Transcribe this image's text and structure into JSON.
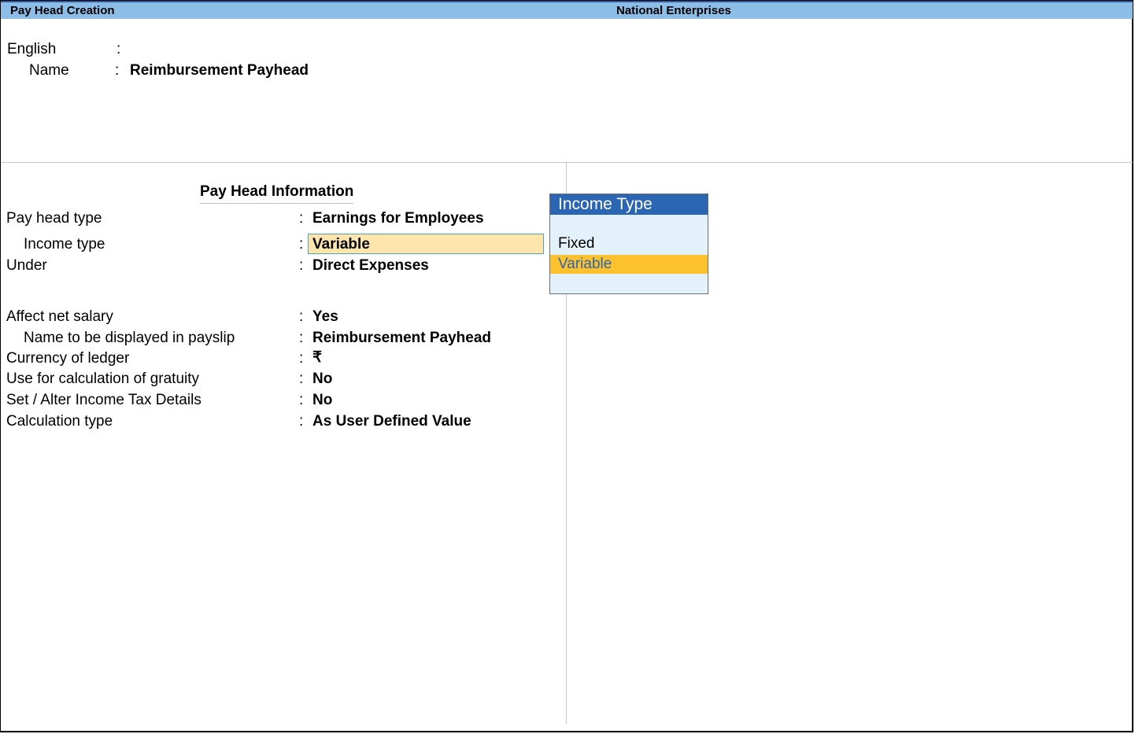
{
  "titlebar": {
    "screen_title": "Pay Head  Creation",
    "company": "National Enterprises"
  },
  "name_section": {
    "language_label": "English",
    "name_label": "Name",
    "name_value": "Reimbursement Payhead",
    "separator": ":"
  },
  "info_section": {
    "title": "Pay Head Information",
    "fields": [
      {
        "label": "Pay head type",
        "value": "Earnings for Employees"
      },
      {
        "label": "Income type",
        "value": "Variable"
      },
      {
        "label": "Under",
        "value": "Direct Expenses"
      },
      {
        "label": "Affect net salary",
        "value": "Yes"
      },
      {
        "label": "Name to be displayed in payslip",
        "value": "Reimbursement Payhead"
      },
      {
        "label": "Currency of ledger",
        "value": "₹"
      },
      {
        "label": "Use for calculation of gratuity",
        "value": "No"
      },
      {
        "label": "Set / Alter Income Tax Details",
        "value": "No"
      },
      {
        "label": "Calculation type",
        "value": "As User Defined Value"
      }
    ]
  },
  "popup": {
    "title": "Income Type",
    "options": [
      "Fixed",
      "Variable"
    ],
    "selected": "Variable"
  },
  "colors": {
    "titlebar_bg": "#8bbde6",
    "popup_header_bg": "#2a66b3",
    "popup_bg": "#e3f1fb",
    "selection_bg": "#fdc12e",
    "active_field_bg": "#fde5ad"
  }
}
